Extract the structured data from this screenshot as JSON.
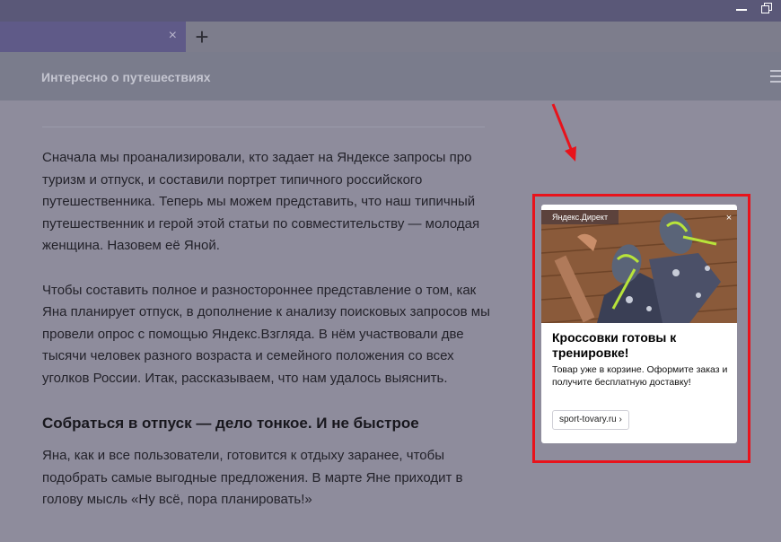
{
  "window": {
    "minimize_icon": "minimize-icon",
    "restore_icon": "restore-icon"
  },
  "tabbar": {
    "close_glyph": "×",
    "new_tab_glyph": "+"
  },
  "site": {
    "title": "Интересно о путешествиях",
    "menu_icon": "hamburger-menu-icon"
  },
  "article": {
    "paragraphs": [
      "Сначала мы проанализировали, кто задает на Яндексе запросы про туризм и отпуск, и составили портрет типичного российского путешественника. Теперь мы можем представить, что наш типичный путешественник и герой этой статьи по совместительству — молодая женщина. Назовем её Яной.",
      "Чтобы составить полное и разностороннее представление о том, как Яна планирует отпуск, в дополнение к анализу поисковых запросов мы провели опрос с помощью Яндекс.Взгляда. В нём участвовали две тысячи человек разного возраста и семейного положения со всех уголков России. Итак, рассказываем, что нам удалось выяснить."
    ],
    "heading": "Собраться в отпуск — дело тонкое. И не быстрое",
    "last_paragraph": "Яна, как и все пользователи, готовится к отдыху заранее, чтобы подобрать самые выгодные предложения. В марте Яне приходит в голову мысль «Ну всё, пора планировать!»"
  },
  "ad": {
    "badge": "Яндекс.Директ",
    "close_glyph": "×",
    "title": "Кроссовки готовы к тренировке!",
    "text": "Товар уже в корзине. Оформите заказ и получите бесплатную доставку!",
    "link": "sport-tovary.ru ›",
    "highlight_color": "#e8131b"
  },
  "colors": {
    "accent_red": "#e8131b",
    "tab_active": "#5f5a88"
  }
}
